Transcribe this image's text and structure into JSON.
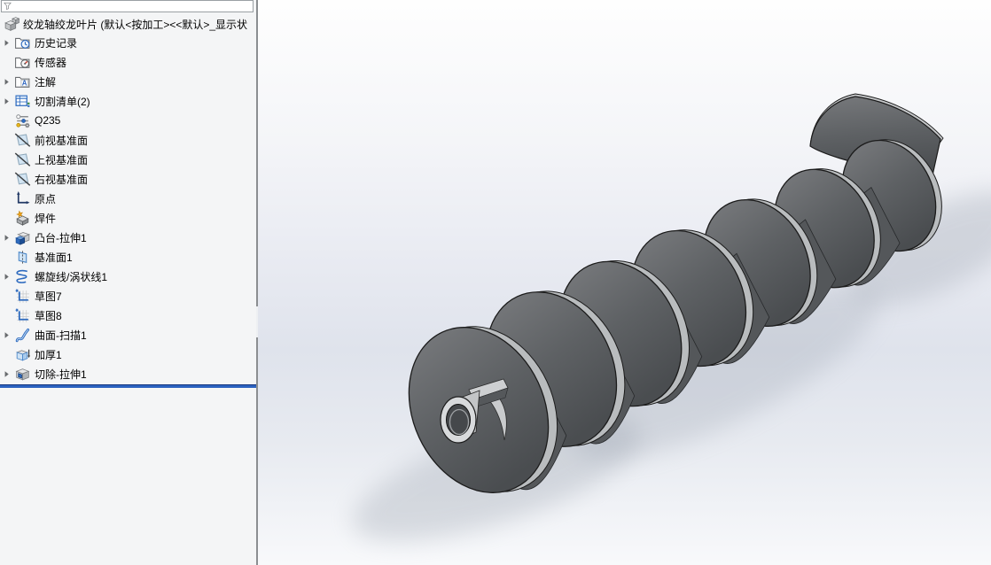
{
  "feature_tree": {
    "filter_value": "",
    "filter_placeholder": "",
    "part_name": "绞龙轴绞龙叶片 (默认<按加工><<默认>_显示状",
    "items": [
      {
        "label": "历史记录",
        "icon": "history-folder",
        "expandable": true
      },
      {
        "label": "传感器",
        "icon": "sensors-folder",
        "expandable": false
      },
      {
        "label": "注解",
        "icon": "annotations-folder",
        "expandable": true
      },
      {
        "label": "切割清单(2)",
        "icon": "cut-list",
        "expandable": true
      },
      {
        "label": "Q235",
        "icon": "material",
        "expandable": false
      },
      {
        "label": "前视基准面",
        "icon": "ref-plane",
        "expandable": false
      },
      {
        "label": "上视基准面",
        "icon": "ref-plane",
        "expandable": false
      },
      {
        "label": "右视基准面",
        "icon": "ref-plane",
        "expandable": false
      },
      {
        "label": "原点",
        "icon": "origin",
        "expandable": false
      },
      {
        "label": "焊件",
        "icon": "weldment",
        "expandable": false
      },
      {
        "label": "凸台-拉伸1",
        "icon": "boss-extrude",
        "expandable": true
      },
      {
        "label": "基准面1",
        "icon": "plane1",
        "expandable": false
      },
      {
        "label": "螺旋线/涡状线1",
        "icon": "helix",
        "expandable": true
      },
      {
        "label": "草图7",
        "icon": "sketch",
        "expandable": false
      },
      {
        "label": "草图8",
        "icon": "sketch",
        "expandable": false
      },
      {
        "label": "曲面-扫描1",
        "icon": "surface-sweep",
        "expandable": true
      },
      {
        "label": "加厚1",
        "icon": "thicken",
        "expandable": false
      },
      {
        "label": "切除-拉伸1",
        "icon": "cut-extrude",
        "expandable": true
      }
    ]
  },
  "colors": {
    "rollback_blue": "#2c62c0",
    "panel_background": "#f4f5f6",
    "flight_gray": "#5d6063",
    "shaft_gray": "#a7aaad",
    "viewport_top": "#fefefe",
    "viewport_mid": "#dfe3ec"
  }
}
